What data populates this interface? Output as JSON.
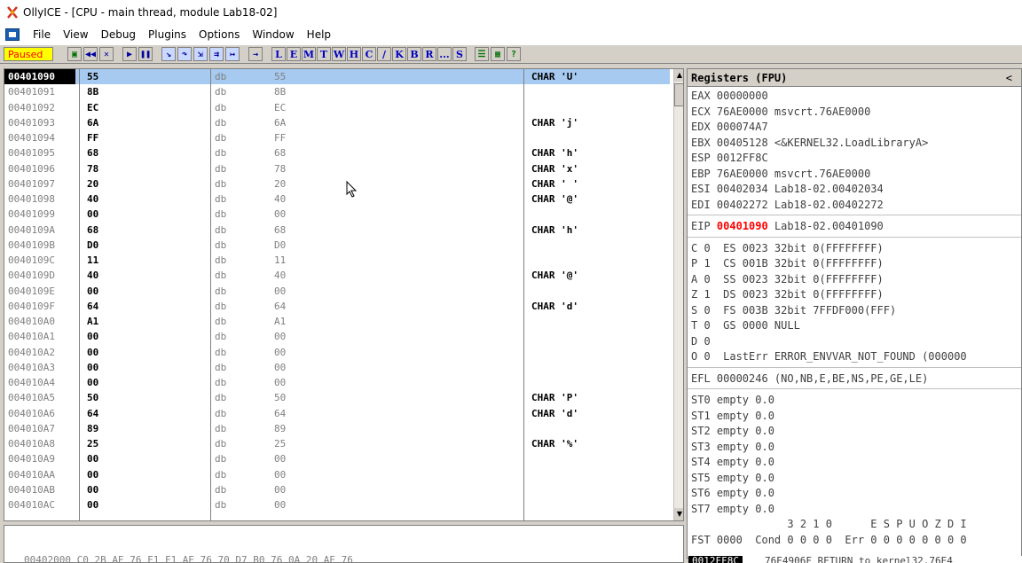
{
  "window": {
    "title": "OllyICE - [CPU - main thread, module Lab18-02]"
  },
  "menu": {
    "items": [
      "File",
      "View",
      "Debug",
      "Plugins",
      "Options",
      "Window",
      "Help"
    ]
  },
  "toolbar": {
    "status": "Paused",
    "letters": [
      "L",
      "E",
      "M",
      "T",
      "W",
      "H",
      "C",
      "/",
      "K",
      "B",
      "R",
      "...",
      "S"
    ]
  },
  "disasm": {
    "rows": [
      {
        "addr": "00401090",
        "hex": "55",
        "mnem": "db",
        "oper": "55",
        "comment": "CHAR 'U'"
      },
      {
        "addr": "00401091",
        "hex": "8B",
        "mnem": "db",
        "oper": "8B",
        "comment": ""
      },
      {
        "addr": "00401092",
        "hex": "EC",
        "mnem": "db",
        "oper": "EC",
        "comment": ""
      },
      {
        "addr": "00401093",
        "hex": "6A",
        "mnem": "db",
        "oper": "6A",
        "comment": "CHAR 'j'"
      },
      {
        "addr": "00401094",
        "hex": "FF",
        "mnem": "db",
        "oper": "FF",
        "comment": ""
      },
      {
        "addr": "00401095",
        "hex": "68",
        "mnem": "db",
        "oper": "68",
        "comment": "CHAR 'h'"
      },
      {
        "addr": "00401096",
        "hex": "78",
        "mnem": "db",
        "oper": "78",
        "comment": "CHAR 'x'"
      },
      {
        "addr": "00401097",
        "hex": "20",
        "mnem": "db",
        "oper": "20",
        "comment": "CHAR ' '"
      },
      {
        "addr": "00401098",
        "hex": "40",
        "mnem": "db",
        "oper": "40",
        "comment": "CHAR '@'"
      },
      {
        "addr": "00401099",
        "hex": "00",
        "mnem": "db",
        "oper": "00",
        "comment": ""
      },
      {
        "addr": "0040109A",
        "hex": "68",
        "mnem": "db",
        "oper": "68",
        "comment": "CHAR 'h'"
      },
      {
        "addr": "0040109B",
        "hex": "D0",
        "mnem": "db",
        "oper": "D0",
        "comment": ""
      },
      {
        "addr": "0040109C",
        "hex": "11",
        "mnem": "db",
        "oper": "11",
        "comment": ""
      },
      {
        "addr": "0040109D",
        "hex": "40",
        "mnem": "db",
        "oper": "40",
        "comment": "CHAR '@'"
      },
      {
        "addr": "0040109E",
        "hex": "00",
        "mnem": "db",
        "oper": "00",
        "comment": ""
      },
      {
        "addr": "0040109F",
        "hex": "64",
        "mnem": "db",
        "oper": "64",
        "comment": "CHAR 'd'"
      },
      {
        "addr": "004010A0",
        "hex": "A1",
        "mnem": "db",
        "oper": "A1",
        "comment": ""
      },
      {
        "addr": "004010A1",
        "hex": "00",
        "mnem": "db",
        "oper": "00",
        "comment": ""
      },
      {
        "addr": "004010A2",
        "hex": "00",
        "mnem": "db",
        "oper": "00",
        "comment": ""
      },
      {
        "addr": "004010A3",
        "hex": "00",
        "mnem": "db",
        "oper": "00",
        "comment": ""
      },
      {
        "addr": "004010A4",
        "hex": "00",
        "mnem": "db",
        "oper": "00",
        "comment": ""
      },
      {
        "addr": "004010A5",
        "hex": "50",
        "mnem": "db",
        "oper": "50",
        "comment": "CHAR 'P'"
      },
      {
        "addr": "004010A6",
        "hex": "64",
        "mnem": "db",
        "oper": "64",
        "comment": "CHAR 'd'"
      },
      {
        "addr": "004010A7",
        "hex": "89",
        "mnem": "db",
        "oper": "89",
        "comment": ""
      },
      {
        "addr": "004010A8",
        "hex": "25",
        "mnem": "db",
        "oper": "25",
        "comment": "CHAR '%'"
      },
      {
        "addr": "004010A9",
        "hex": "00",
        "mnem": "db",
        "oper": "00",
        "comment": ""
      },
      {
        "addr": "004010AA",
        "hex": "00",
        "mnem": "db",
        "oper": "00",
        "comment": ""
      },
      {
        "addr": "004010AB",
        "hex": "00",
        "mnem": "db",
        "oper": "00",
        "comment": ""
      },
      {
        "addr": "004010AC",
        "hex": "00",
        "mnem": "db",
        "oper": "00",
        "comment": ""
      }
    ]
  },
  "registers": {
    "header": "Registers (FPU)",
    "collapse": "<",
    "general": [
      "EAX 00000000",
      "ECX 76AE0000 msvcrt.76AE0000",
      "EDX 000074A7",
      "EBX 00405128 <&KERNEL32.LoadLibraryA>",
      "ESP 0012FF8C",
      "EBP 76AE0000 msvcrt.76AE0000",
      "ESI 00402034 Lab18-02.00402034",
      "EDI 00402272 Lab18-02.00402272"
    ],
    "eip": {
      "label": "EIP",
      "value": "00401090",
      "rest": "Lab18-02.00401090"
    },
    "flags": [
      "C 0  ES 0023 32bit 0(FFFFFFFF)",
      "P 1  CS 001B 32bit 0(FFFFFFFF)",
      "A 0  SS 0023 32bit 0(FFFFFFFF)",
      "Z 1  DS 0023 32bit 0(FFFFFFFF)",
      "S 0  FS 003B 32bit 7FFDF000(FFF)",
      "T 0  GS 0000 NULL",
      "D 0",
      "O 0  LastErr ERROR_ENVVAR_NOT_FOUND (000000"
    ],
    "efl": "EFL 00000246 (NO,NB,E,BE,NS,PE,GE,LE)",
    "fpu": [
      "ST0 empty 0.0",
      "ST1 empty 0.0",
      "ST2 empty 0.0",
      "ST3 empty 0.0",
      "ST4 empty 0.0",
      "ST5 empty 0.0",
      "ST6 empty 0.0",
      "ST7 empty 0.0"
    ],
    "fpu_bits_header": "               3 2 1 0      E S P U O Z D I",
    "fst": "FST 0000  Cond 0 0 0 0  Err 0 0 0 0 0 0 0 0"
  },
  "dump": {
    "line": "00402000 C0 2B AE 76 F1 F1 AE 76 70 D7 B0 76 0A 20 AE 76"
  },
  "stack": {
    "addr": "0012FF8C",
    "value": "76E4906F RETURN to kernel32.76E4"
  },
  "colors": {
    "selection": "#a6caf0",
    "status_bg": "#ffff00",
    "status_fg": "#ff0000",
    "eip_value": "#ff0000"
  }
}
